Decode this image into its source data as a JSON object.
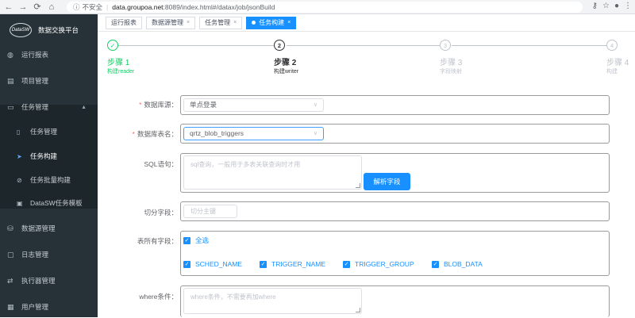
{
  "browser": {
    "insecure_label": "不安全",
    "host": "data.groupoa.net",
    "path": ":8089/index.html#/datax/job/jsonBuild"
  },
  "sidebar": {
    "logo_text": "DataSW",
    "title": "数据交换平台",
    "items": [
      {
        "label": "运行报表",
        "icon": "dashboard-icon"
      },
      {
        "label": "项目管理",
        "icon": "project-icon"
      },
      {
        "label": "任务管理",
        "icon": "monitor-icon"
      },
      {
        "label": "数据源管理",
        "icon": "database-icon"
      },
      {
        "label": "日志管理",
        "icon": "log-icon"
      },
      {
        "label": "执行器管理",
        "icon": "executor-icon"
      },
      {
        "label": "用户管理",
        "icon": "user-icon"
      }
    ],
    "sub_items": [
      {
        "label": "任务管理",
        "icon": "file-icon"
      },
      {
        "label": "任务构建",
        "icon": "send-icon"
      },
      {
        "label": "任务批量构建",
        "icon": "batch-icon"
      },
      {
        "label": "DataSW任务模板",
        "icon": "template-icon"
      }
    ]
  },
  "tabs": [
    {
      "label": "运行报表"
    },
    {
      "label": "数据源管理"
    },
    {
      "label": "任务管理"
    },
    {
      "label": "任务构建"
    }
  ],
  "steps": [
    {
      "title": "步骤 1",
      "desc": "构建reader",
      "num": "1"
    },
    {
      "title": "步骤 2",
      "desc": "构建writer",
      "num": "2"
    },
    {
      "title": "步骤 3",
      "desc": "字段映射",
      "num": "3"
    },
    {
      "title": "步骤 4",
      "desc": "构建",
      "num": "4"
    }
  ],
  "form": {
    "datasource_label": "数据库源：",
    "datasource_value": "单点登录",
    "table_label": "数据库表名：",
    "table_value": "qrtz_blob_triggers",
    "sql_label": "SQL语句：",
    "sql_placeholder": "sql查询，一般用于多表关联查询时才用",
    "parse_button": "解析字段",
    "split_label": "切分字段：",
    "split_placeholder": "切分主键",
    "fields_label": "表所有字段：",
    "select_all": "全选",
    "columns": [
      "SCHED_NAME",
      "TRIGGER_NAME",
      "TRIGGER_GROUP",
      "BLOB_DATA"
    ],
    "where_label": "where条件：",
    "where_placeholder": "where条件，不需要再加where"
  }
}
